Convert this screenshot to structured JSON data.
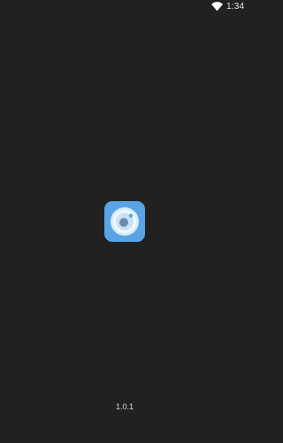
{
  "status_bar": {
    "time": "1:34",
    "wifi_icon": "wifi-icon"
  },
  "splash": {
    "app_icon": "camera-lens-icon",
    "version": "1.0.1"
  },
  "colors": {
    "background": "#212121",
    "icon_blue": "#5aa4e6",
    "icon_light": "#d7ecfb"
  }
}
